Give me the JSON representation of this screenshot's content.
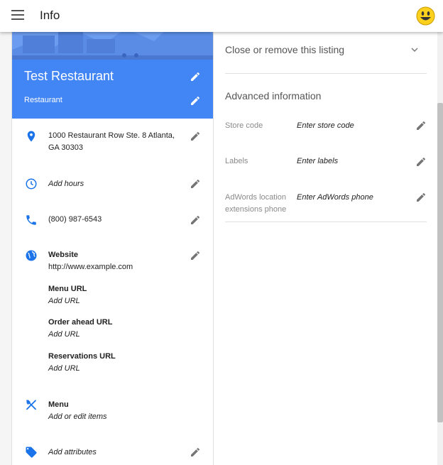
{
  "topbar": {
    "title": "Info",
    "menu_icon": "menu-icon",
    "avatar_icon": "smiley-icon"
  },
  "business": {
    "name": "Test Restaurant",
    "category": "Restaurant"
  },
  "info": {
    "address": {
      "line1": "1000 Restaurant Row Ste. 8 Atlanta,",
      "line2": "GA 30303"
    },
    "hours": "Add hours",
    "phone": "(800) 987-6543",
    "website": {
      "label": "Website",
      "url": "http://www.example.com",
      "menu_url": {
        "label": "Menu URL",
        "value": "Add URL"
      },
      "order_url": {
        "label": "Order ahead URL",
        "value": "Add URL"
      },
      "reservations_url": {
        "label": "Reservations URL",
        "value": "Add URL"
      }
    },
    "menu": {
      "label": "Menu",
      "value": "Add or edit items"
    },
    "attributes": "Add attributes"
  },
  "right_panel": {
    "close_listing": "Close or remove this listing",
    "advanced_title": "Advanced information",
    "fields": [
      {
        "label": "Store code",
        "value": "Enter store code"
      },
      {
        "label": "Labels",
        "value": "Enter labels"
      },
      {
        "label_line1": "AdWords location",
        "label_line2": "extensions phone",
        "value": "Enter AdWords phone"
      }
    ]
  },
  "colors": {
    "accent": "#4285f4",
    "banner": "#6b9cf0",
    "icon": "#1a73e8"
  }
}
